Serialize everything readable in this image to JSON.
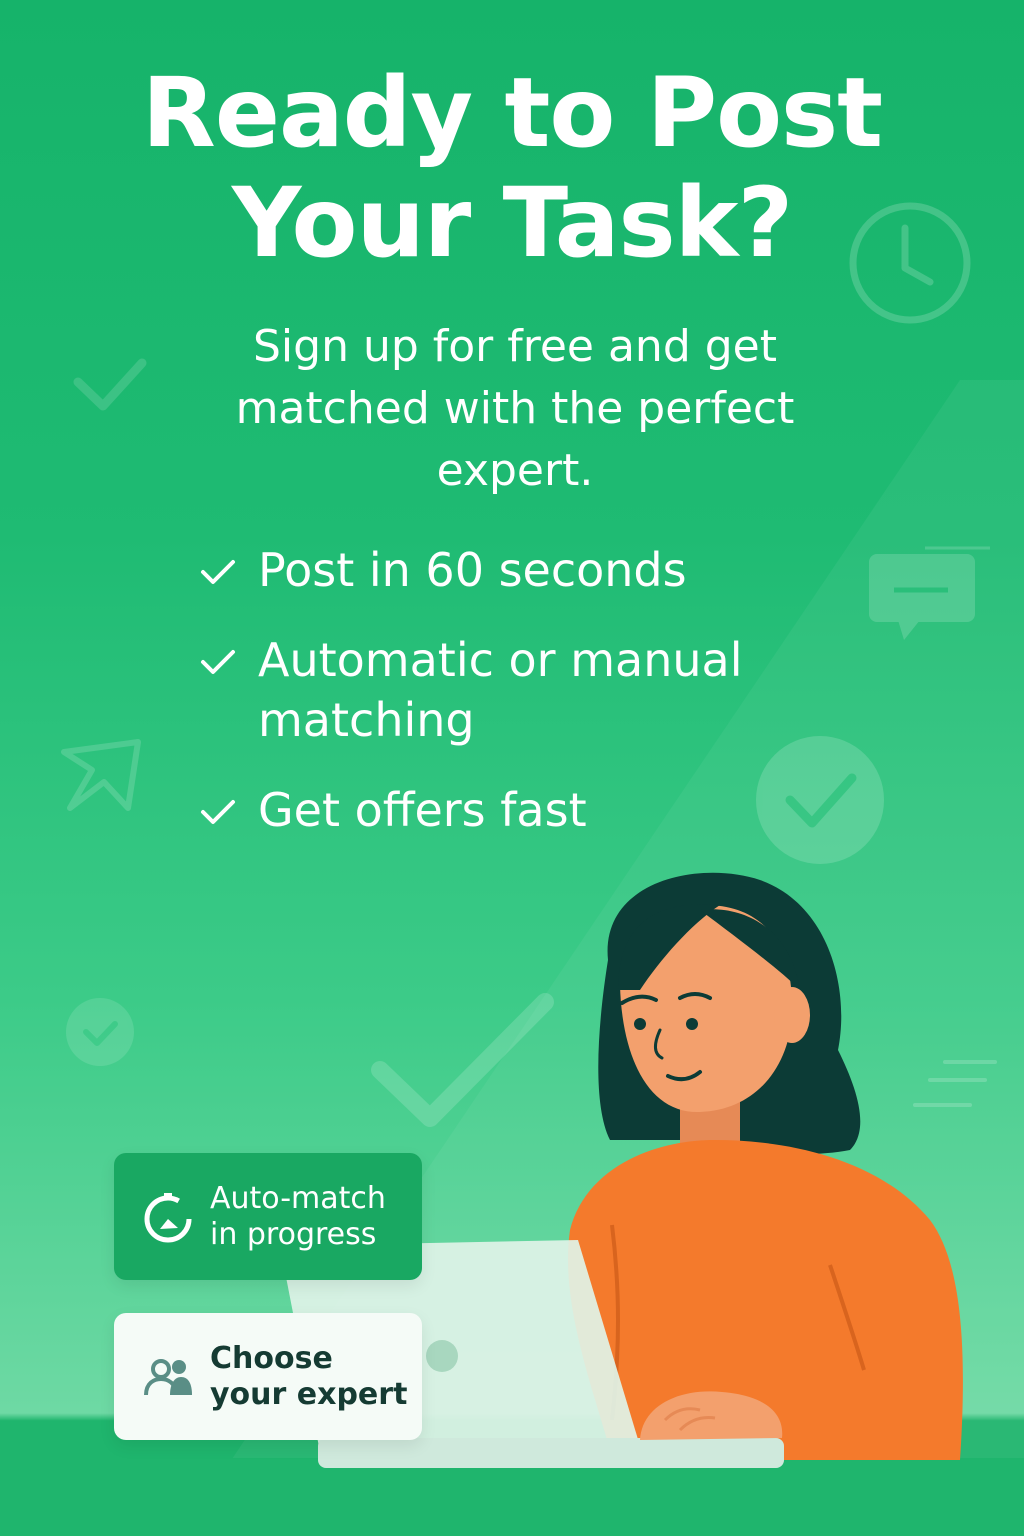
{
  "headline": {
    "line1": "Ready to Post",
    "line2": "Your Task?"
  },
  "subtitle": "Sign up for free and get matched with the perfect expert.",
  "features": [
    "Post in 60 seconds",
    "Automatic or manual matching",
    "Get offers fast"
  ],
  "cards": {
    "auto_match": "Auto-match in progress",
    "choose_expert": "Choose your expert"
  },
  "colors": {
    "background_top": "#16b36a",
    "background_bottom": "#6ed9a4",
    "sweater": "#f47a2c",
    "hair": "#0c3b36",
    "skin": "#f3a06d",
    "card_green": "#19a862",
    "card_white": "#f5fbf7"
  },
  "icons": [
    "checkmark-icon",
    "clock-icon",
    "chat-bubble-icon",
    "paper-plane-icon",
    "check-circle-icon",
    "progress-ring-icon",
    "people-icon"
  ]
}
